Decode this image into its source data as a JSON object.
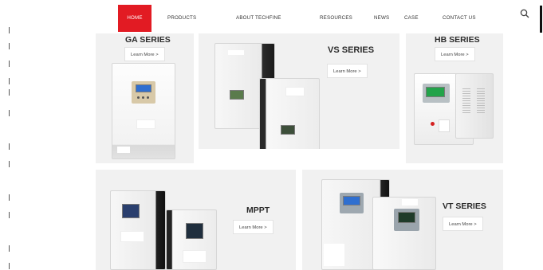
{
  "nav": {
    "items": [
      {
        "label": "HOME",
        "active": true
      },
      {
        "label": "PRODUCTS",
        "active": false
      },
      {
        "label": "ABOUT TECHFINE",
        "active": false
      },
      {
        "label": "RESOURCES",
        "active": false
      },
      {
        "label": "NEWS",
        "active": false
      },
      {
        "label": "CASE",
        "active": false
      },
      {
        "label": "CONTACT US",
        "active": false
      }
    ],
    "search_icon": "search-icon",
    "active_color": "#e21b23"
  },
  "products": {
    "ga": {
      "title": "GA SERIES",
      "button": "Learn More >"
    },
    "vs": {
      "title": "VS SERIES",
      "button": "Learn More >"
    },
    "hb": {
      "title": "HB SERIES",
      "button": "Learn More >"
    },
    "mppt": {
      "title": "MPPT",
      "button": "Learn More >"
    },
    "vt": {
      "title": "VT SERIES",
      "button": "Learn More >"
    }
  }
}
